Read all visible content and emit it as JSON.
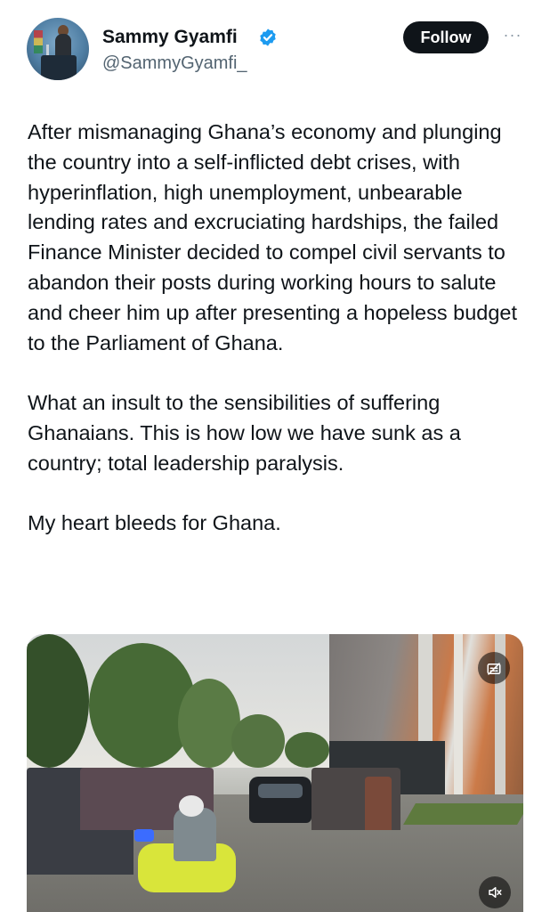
{
  "author": {
    "display_name": "Sammy Gyamfi",
    "handle": "@SammyGyamfi_",
    "verified": true,
    "avatar_icon": "profile-photo-podium"
  },
  "actions": {
    "follow_label": "Follow",
    "more_label": "···"
  },
  "post": {
    "paragraphs": [
      "After mismanaging Ghana’s economy and plunging the country into a self-inflicted debt crises, with hyperinflation, high unemployment, unbearable lending rates and excruciating hardships, the failed Finance Minister decided to compel civil servants to abandon their posts during working hours to salute and cheer him up after presenting a hopeless budget to the Parliament of Ghana.",
      "What an insult to the sensibilities of suffering Ghanaians. This is how low we have sunk as a country; total leadership paralysis.",
      "My heart bleeds for Ghana."
    ]
  },
  "media": {
    "type": "video",
    "captions_icon": "captions-icon",
    "mute_icon": "muted-speaker-icon"
  },
  "colors": {
    "text": "#0f1419",
    "secondary_text": "#536471",
    "verified_blue": "#1d9bf0",
    "follow_bg": "#0f1419"
  }
}
